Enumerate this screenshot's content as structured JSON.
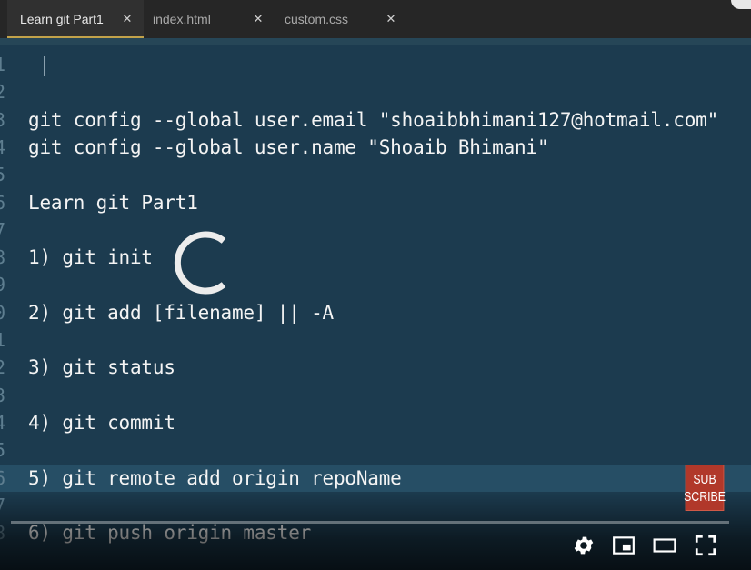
{
  "tabs": [
    {
      "label": "Learn git Part1",
      "active": true
    },
    {
      "label": "index.html",
      "active": false
    },
    {
      "label": "custom.css",
      "active": false
    }
  ],
  "tab_close_glyph": "✕",
  "editor": {
    "lines": [
      {
        "num": "1",
        "text": ""
      },
      {
        "num": "2",
        "text": ""
      },
      {
        "num": "3",
        "text": "git config --global user.email \"shoaibbhimani127@hotmail.com\""
      },
      {
        "num": "4",
        "text": "git config --global user.name \"Shoaib Bhimani\""
      },
      {
        "num": "5",
        "text": ""
      },
      {
        "num": "6",
        "text": "Learn git Part1"
      },
      {
        "num": "7",
        "text": ""
      },
      {
        "num": "8",
        "text": "1) git init"
      },
      {
        "num": "9",
        "text": ""
      },
      {
        "num": "0",
        "text": "2) git add [filename] || -A"
      },
      {
        "num": "1",
        "text": ""
      },
      {
        "num": "2",
        "text": "3) git status"
      },
      {
        "num": "3",
        "text": ""
      },
      {
        "num": "4",
        "text": "4) git commit"
      },
      {
        "num": "5",
        "text": ""
      },
      {
        "num": "6",
        "text": "5) git remote add origin repoName",
        "highlight": true
      },
      {
        "num": "7",
        "text": ""
      },
      {
        "num": "8",
        "text": "6) git push origin master"
      }
    ]
  },
  "player": {
    "subscribe_line1": "SUB",
    "subscribe_line2": "SCRIBE",
    "controls": [
      "settings-icon",
      "miniplayer-icon",
      "theater-mode-icon",
      "fullscreen-icon"
    ]
  },
  "colors": {
    "editor_bg": "#1c3b4f",
    "highlight_bg": "#264e65",
    "tab_bg": "#262626",
    "active_tab_underline": "#c2a24a",
    "subscribe_bg": "#b1382a"
  }
}
